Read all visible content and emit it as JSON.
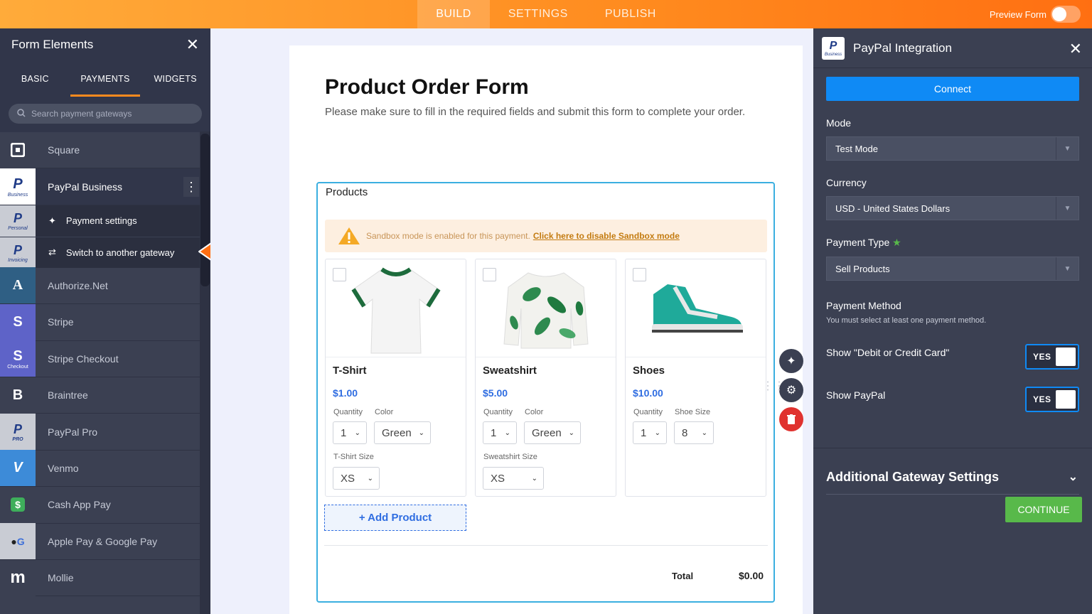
{
  "topbar": {
    "tabs": [
      "BUILD",
      "SETTINGS",
      "PUBLISH"
    ],
    "preview_label": "Preview Form"
  },
  "left": {
    "title": "Form Elements",
    "tabs": [
      "BASIC",
      "PAYMENTS",
      "WIDGETS"
    ],
    "search_placeholder": "Search payment gateways",
    "gateways": [
      {
        "label": "Square",
        "icon": "square-icon",
        "color": "#3b4052"
      },
      {
        "label": "PayPal Business",
        "icon": "paypal-business-icon",
        "color": "#ffffff"
      },
      {
        "label": "Authorize.Net",
        "icon": "authorize-net-icon",
        "color": "#2f5f84",
        "glyph": "A"
      },
      {
        "label": "Stripe",
        "icon": "stripe-icon",
        "color": "#5e63c8",
        "glyph": "S"
      },
      {
        "label": "Stripe Checkout",
        "icon": "stripe-checkout-icon",
        "color": "#5e63c8",
        "glyph": "S",
        "sub": "Checkout"
      },
      {
        "label": "Braintree",
        "icon": "braintree-icon",
        "color": "#3b4052",
        "glyph": "B"
      },
      {
        "label": "PayPal Pro",
        "icon": "paypal-pro-icon",
        "color": "#c9ccd4",
        "sub": "PRO"
      },
      {
        "label": "Venmo",
        "icon": "venmo-icon",
        "color": "#3d8bd8",
        "glyph": "V"
      },
      {
        "label": "Cash App Pay",
        "icon": "cash-app-icon",
        "color": "#3b4052",
        "glyph": "$"
      },
      {
        "label": "Apple Pay & Google Pay",
        "icon": "apple-google-pay-icon",
        "color": "#c9ccd4",
        "glyph": "G"
      },
      {
        "label": "Mollie",
        "icon": "mollie-icon",
        "color": "#3b4052",
        "glyph": "m"
      }
    ],
    "paypal_sub_icons": [
      {
        "sub": "Personal"
      },
      {
        "sub": "Invoicing"
      }
    ],
    "submenu": [
      "Payment settings",
      "Switch to another gateway"
    ],
    "business_sub": "Business"
  },
  "form": {
    "title": "Product Order Form",
    "description": "Please make sure to fill in the required fields and submit this form to complete your order.",
    "products_label": "Products",
    "sandbox_text": "Sandbox mode is enabled for this payment.",
    "sandbox_link": "Click here to disable Sandbox mode",
    "products": [
      {
        "name": "T-Shirt",
        "price": "$1.00",
        "opt1_label": "Quantity",
        "opt1_val": "1",
        "opt2_label": "Color",
        "opt2_val": "Green",
        "opt3_label": "T-Shirt Size",
        "opt3_val": "XS"
      },
      {
        "name": "Sweatshirt",
        "price": "$5.00",
        "opt1_label": "Quantity",
        "opt1_val": "1",
        "opt2_label": "Color",
        "opt2_val": "Green",
        "opt3_label": "Sweatshirt Size",
        "opt3_val": "XS"
      },
      {
        "name": "Shoes",
        "price": "$10.00",
        "opt1_label": "Quantity",
        "opt1_val": "1",
        "opt2_label": "Shoe Size",
        "opt2_val": "8"
      }
    ],
    "add_product": "+ Add Product",
    "total_label": "Total",
    "total_value": "$0.00"
  },
  "right": {
    "title": "PayPal Integration",
    "connect": "Connect",
    "mode_label": "Mode",
    "mode_value": "Test Mode",
    "currency_label": "Currency",
    "currency_value": "USD - United States Dollars",
    "ptype_label": "Payment Type",
    "ptype_value": "Sell Products",
    "pmethod_label": "Payment Method",
    "pmethod_note": "You must select at least one payment method.",
    "show_card": "Show \"Debit or Credit Card\"",
    "show_paypal": "Show PayPal",
    "yes": "YES",
    "additional": "Additional Gateway Settings",
    "continue": "CONTINUE"
  }
}
